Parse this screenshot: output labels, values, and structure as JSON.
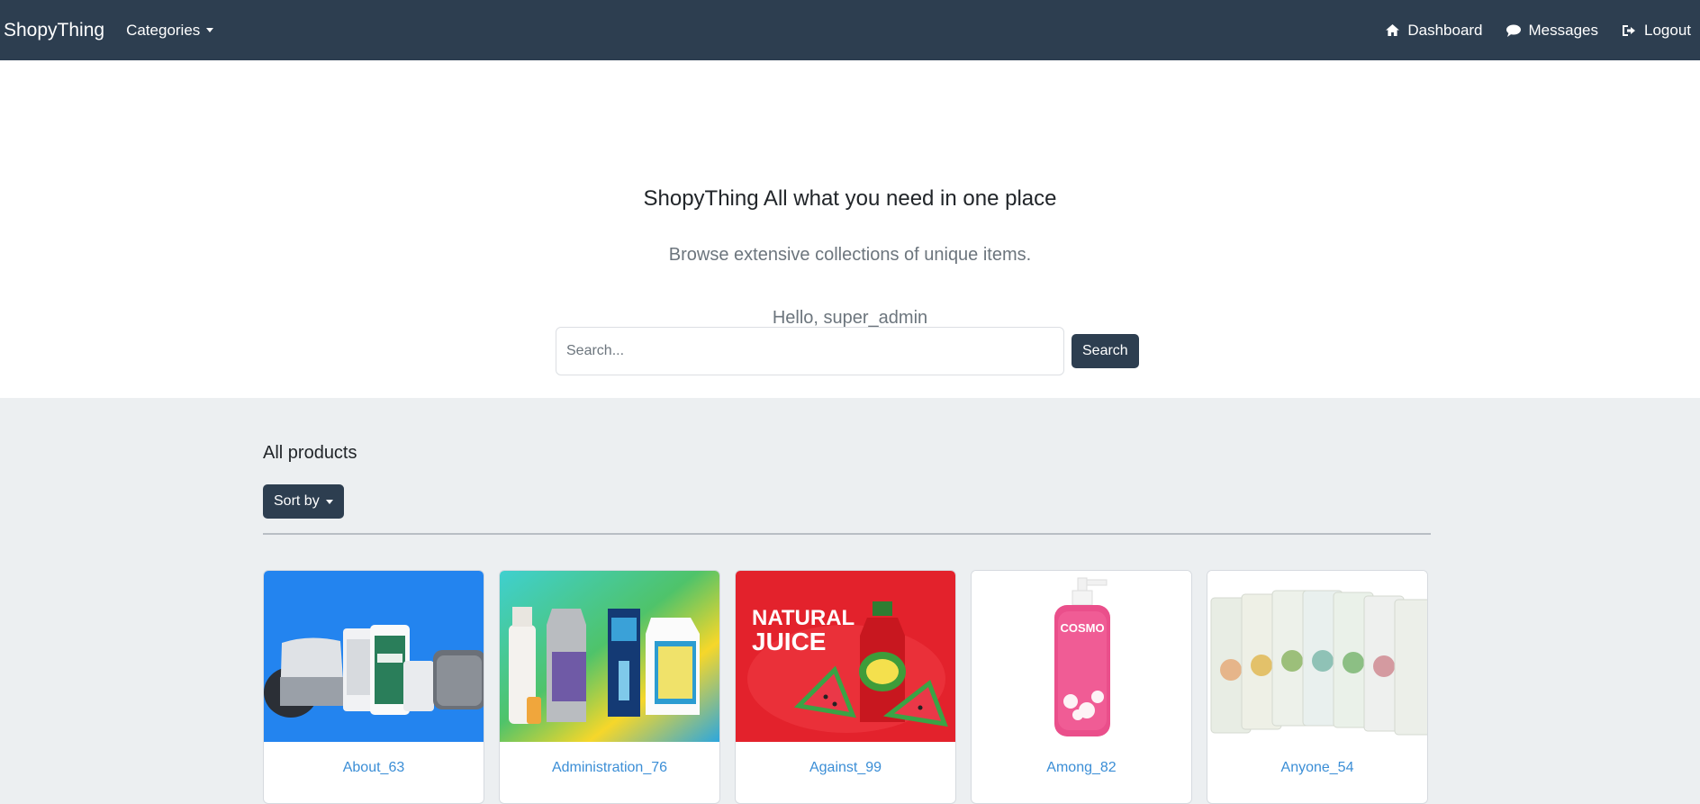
{
  "nav": {
    "brand": "ShopyThing",
    "categories_label": "Categories",
    "dashboard_label": "Dashboard",
    "messages_label": "Messages",
    "logout_label": "Logout"
  },
  "hero": {
    "title": "ShopyThing All what you need in one place",
    "subtitle": "Browse extensive collections of unique items.",
    "greeting": "Hello, super_admin"
  },
  "search": {
    "placeholder": "Search...",
    "button_label": "Search"
  },
  "products": {
    "section_title": "All products",
    "sort_label": "Sort by",
    "items": [
      {
        "name": "About_63"
      },
      {
        "name": "Administration_76"
      },
      {
        "name": "Against_99"
      },
      {
        "name": "Among_82"
      },
      {
        "name": "Anyone_54"
      }
    ]
  },
  "colors": {
    "navbar": "#2d3e50",
    "link": "#3b8ed6",
    "page_bg": "#eceff1"
  }
}
